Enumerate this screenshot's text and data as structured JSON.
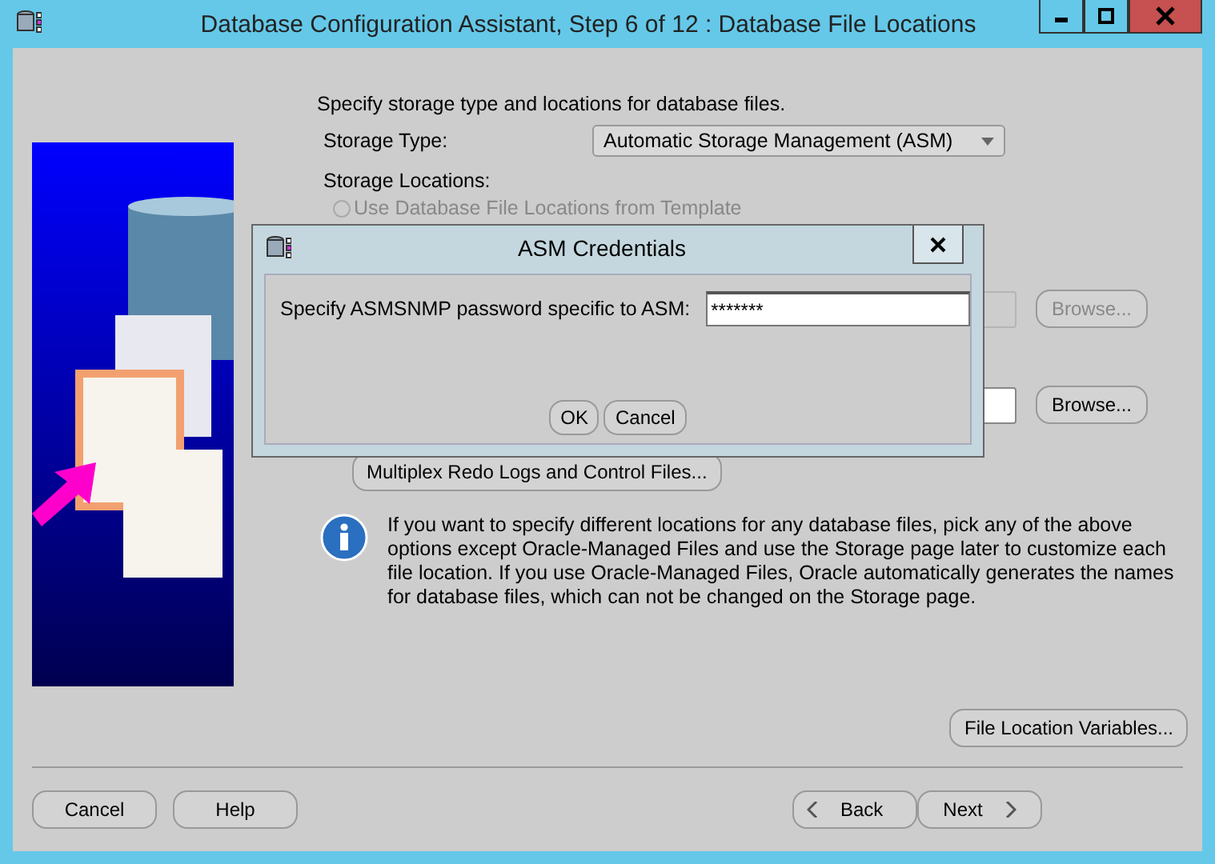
{
  "window": {
    "title": "Database Configuration Assistant, Step 6 of 12 : Database File Locations"
  },
  "intro": "Specify storage type and locations for database files.",
  "storage_type": {
    "label": "Storage Type:",
    "value": "Automatic Storage Management (ASM)"
  },
  "storage_locations_label": "Storage Locations:",
  "location_option": {
    "label": "Use Database File Locations from Template",
    "selected": false,
    "disabled": true
  },
  "location_fields": [
    {
      "disabled": true,
      "browse": "Browse..."
    },
    {
      "disabled": false,
      "browse": "Browse..."
    }
  ],
  "multiplex_button": "Multiplex Redo Logs and Control Files...",
  "info_text": "If you want to specify different locations for any database files, pick any of the above options except Oracle-Managed Files and use the Storage page later to customize each file location. If you use Oracle-Managed Files, Oracle automatically generates the names for database files, which can not be changed on the Storage page.",
  "file_location_variables_button": "File Location Variables...",
  "footer_left": [
    "Cancel",
    "Help"
  ],
  "back_button": "Back",
  "next_button": "Next",
  "dialog": {
    "title": "ASM Credentials",
    "prompt": "Specify ASMSNMP password specific to ASM:",
    "password": "*******",
    "buttons": [
      "OK",
      "Cancel"
    ]
  }
}
